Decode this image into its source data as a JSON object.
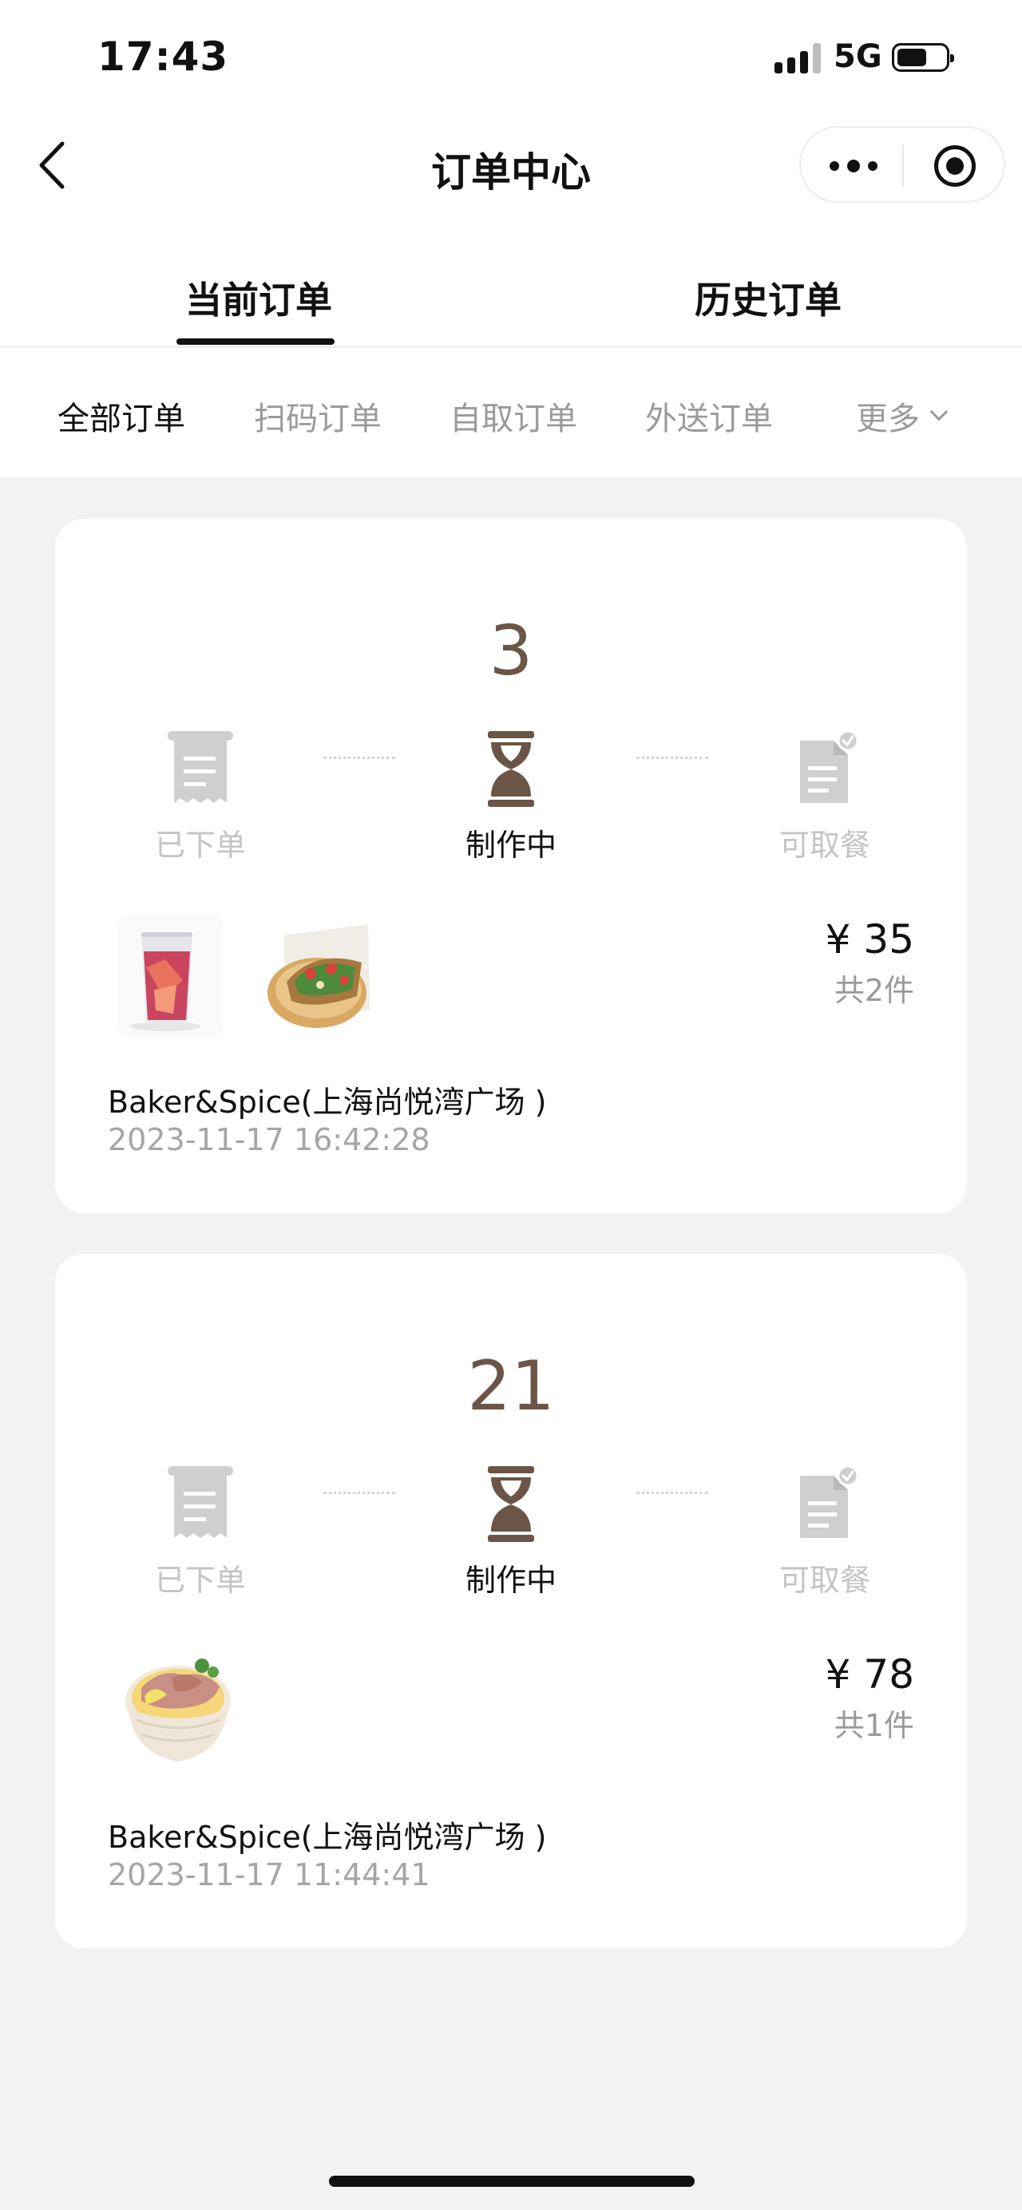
{
  "status_bar": {
    "time": "17:43",
    "network": "5G"
  },
  "nav": {
    "title": "订单中心"
  },
  "tabs": [
    {
      "label": "当前订单",
      "active": true
    },
    {
      "label": "历史订单",
      "active": false
    }
  ],
  "filters": [
    {
      "label": "全部订单",
      "active": true
    },
    {
      "label": "扫码订单",
      "active": false
    },
    {
      "label": "自取订单",
      "active": false
    },
    {
      "label": "外送订单",
      "active": false
    },
    {
      "label": "更多",
      "active": false
    }
  ],
  "orders": [
    {
      "number": "3",
      "steps": [
        {
          "label": "已下单",
          "icon": "receipt-icon",
          "active": false
        },
        {
          "label": "制作中",
          "icon": "hourglass-icon",
          "active": true
        },
        {
          "label": "可取餐",
          "icon": "document-check-icon",
          "active": false
        }
      ],
      "items": [
        {
          "name": "red-fruit-drink",
          "icon": "drink-image"
        },
        {
          "name": "open-toast-plate",
          "icon": "toast-image"
        }
      ],
      "price": "¥ 35",
      "count": "共2件",
      "store": "Baker&Spice(上海尚悦湾广场 )",
      "time": "2023-11-17 16:42:28"
    },
    {
      "number": "21",
      "steps": [
        {
          "label": "已下单",
          "icon": "receipt-icon",
          "active": false
        },
        {
          "label": "制作中",
          "icon": "hourglass-icon",
          "active": true
        },
        {
          "label": "可取餐",
          "icon": "document-check-icon",
          "active": false
        }
      ],
      "items": [
        {
          "name": "noodle-bowl",
          "icon": "noodle-bowl-image"
        }
      ],
      "price": "¥ 78",
      "count": "共1件",
      "store": "Baker&Spice(上海尚悦湾广场 )",
      "time": "2023-11-17 11:44:41"
    }
  ],
  "colors": {
    "accent_brown": "#6b5547",
    "inactive_gray": "#c4c4c4",
    "page_background": "#f2f2f2"
  }
}
